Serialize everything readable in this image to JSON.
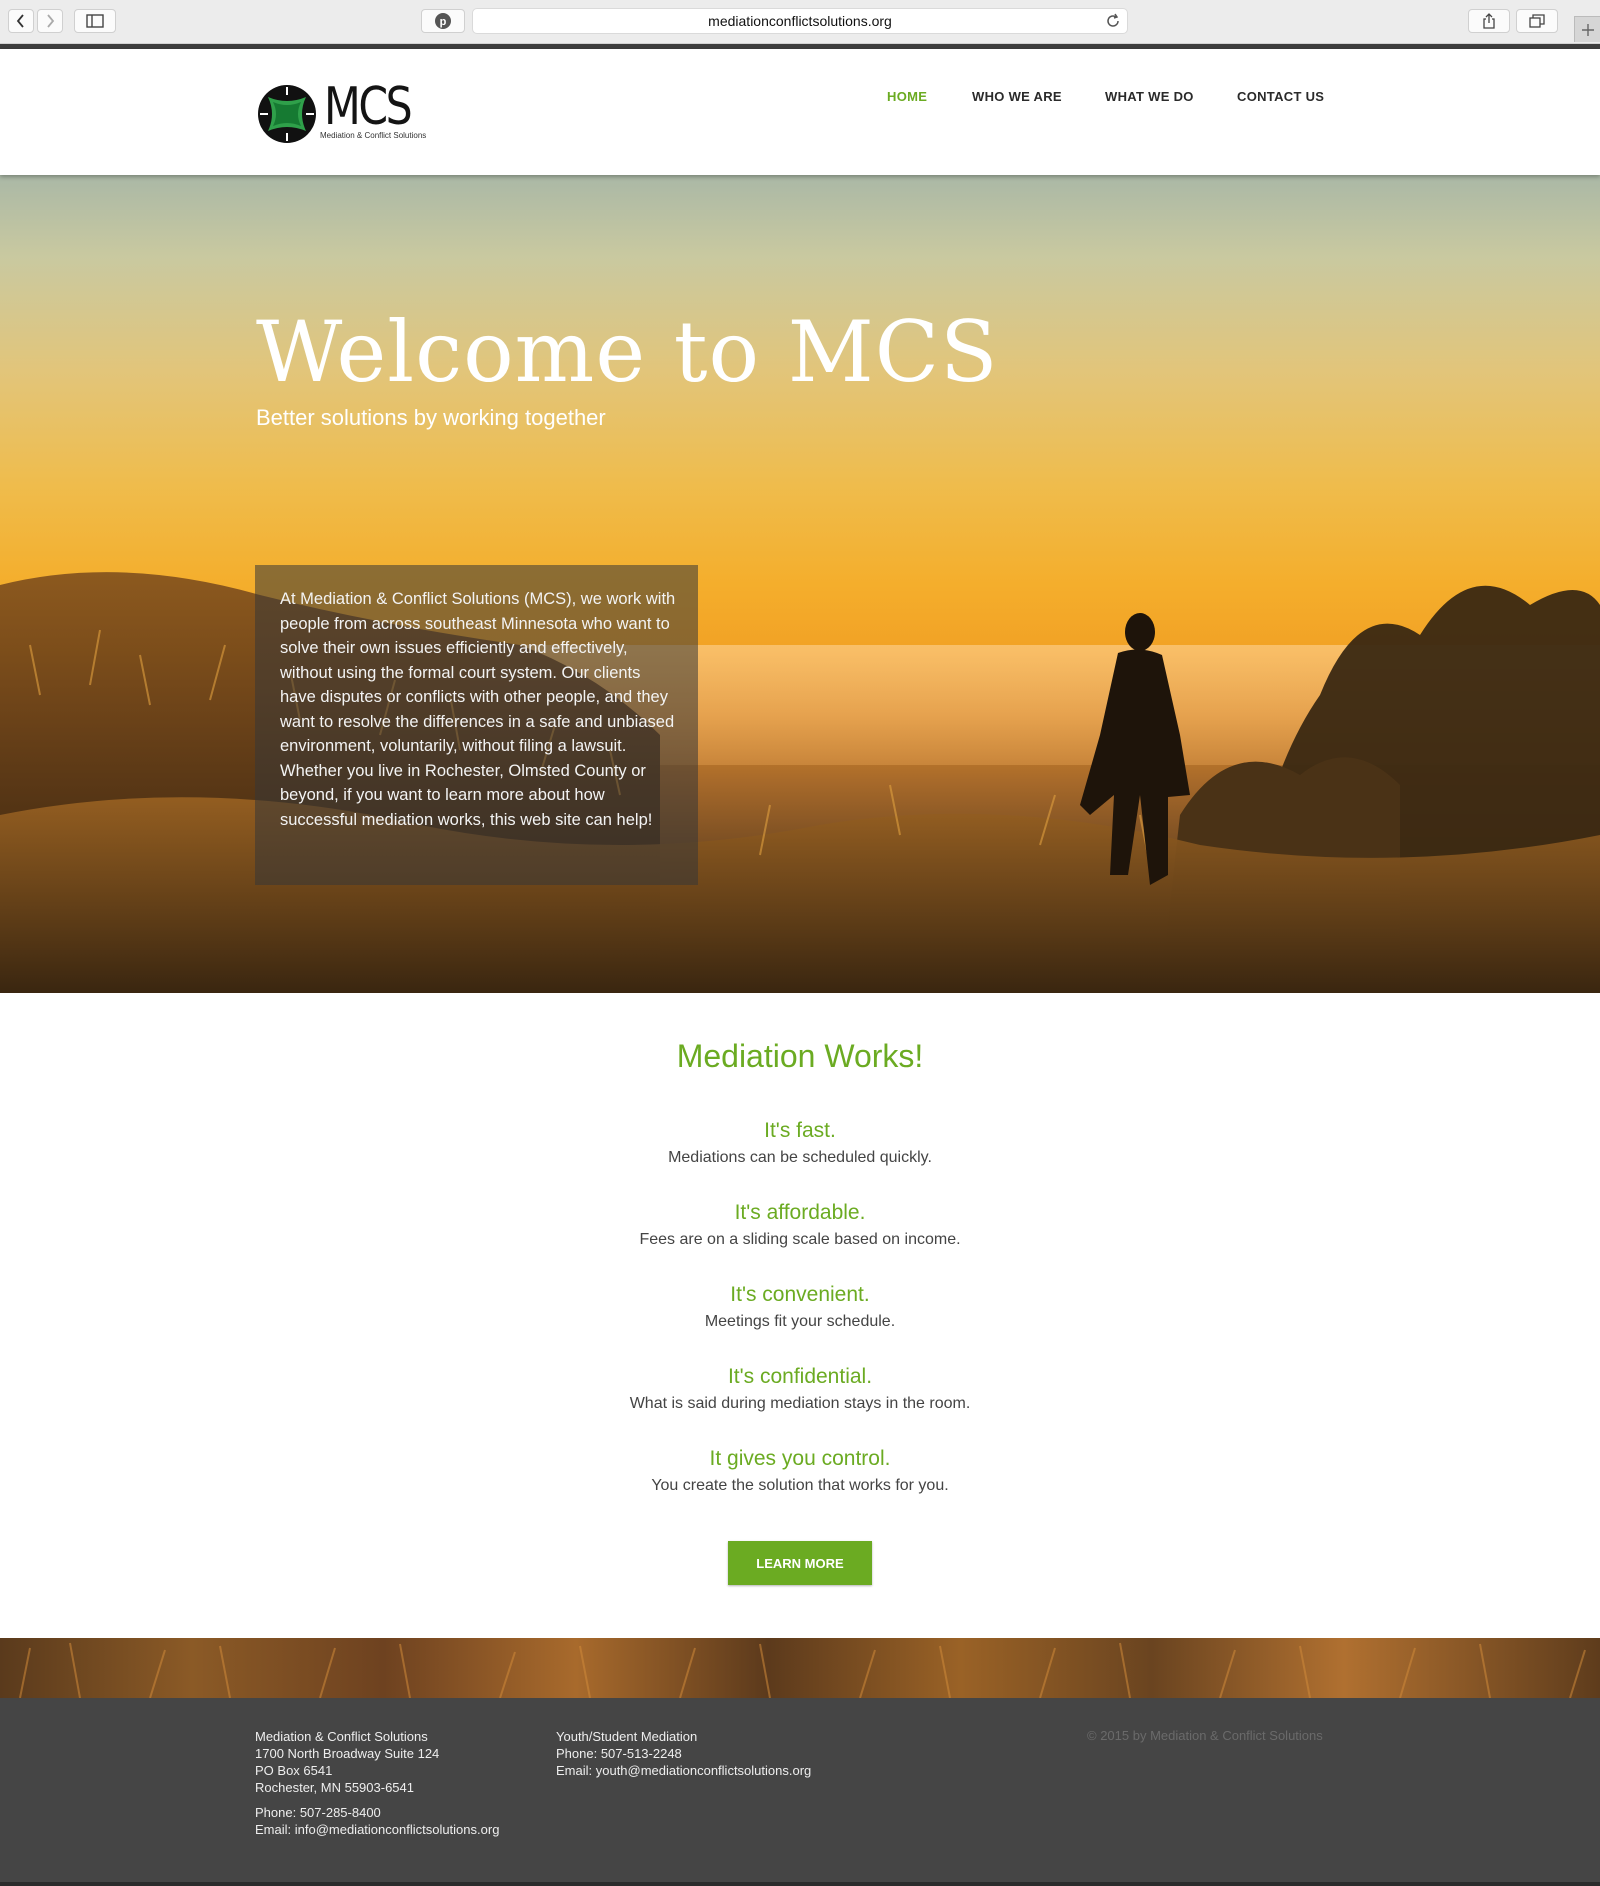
{
  "browser": {
    "url": "mediationconflictsolutions.org"
  },
  "site": {
    "logo_text": "MCS",
    "logo_subtitle": "Mediation & Conflict Solutions",
    "brand_color": "#6bab22"
  },
  "nav": {
    "items": [
      {
        "label": "HOME",
        "active": true
      },
      {
        "label": "WHO WE ARE",
        "active": false
      },
      {
        "label": "WHAT WE DO",
        "active": false
      },
      {
        "label": "CONTACT US",
        "active": false
      }
    ]
  },
  "hero": {
    "title": "Welcome to MCS",
    "subtitle": "Better solutions by working together",
    "intro": "At Mediation & Conflict Solutions (MCS), we work with people from across southeast Minnesota who want to solve their own issues efficiently and effectively, without using the formal court system. Our clients have disputes or conflicts with other people, and they want to resolve the differences in a safe and unbiased environment, voluntarily, without filing a lawsuit.  Whether you live in Rochester, Olmsted County or beyond, if you want to learn more about how successful mediation works, this web site can help!"
  },
  "works": {
    "title": "Mediation Works!",
    "benefits": [
      {
        "heading": "It's fast.",
        "text": "Mediations can be scheduled quickly."
      },
      {
        "heading": "It's affordable.",
        "text": "Fees are on a sliding scale based on income."
      },
      {
        "heading": "It's convenient.",
        "text": "Meetings fit your schedule."
      },
      {
        "heading": "It's confidential.",
        "text": "What is said during mediation stays in the room."
      },
      {
        "heading": "It gives you control.",
        "text": "You create the solution that works for you."
      }
    ],
    "button_label": "LEARN MORE"
  },
  "footer": {
    "col1": {
      "name": "Mediation & Conflict Solutions",
      "address1": "1700 North Broadway Suite 124",
      "address2": "PO Box 6541",
      "address3": "Rochester, MN 55903-6541",
      "phone": "Phone: 507-285-8400",
      "email": "Email: info@mediationconflictsolutions.org"
    },
    "col2": {
      "name": "Youth/Student Mediation",
      "phone": "Phone: 507-513-2248",
      "email": "Email: youth@mediationconflictsolutions.org"
    },
    "copyright": "© 2015 by Mediation & Conflict Solutions"
  }
}
